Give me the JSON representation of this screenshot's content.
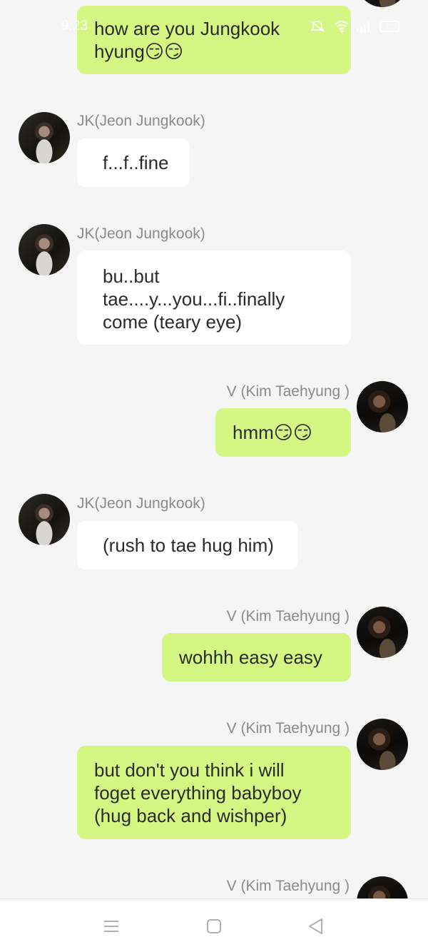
{
  "status_bar": {
    "time": "9:23",
    "battery": "77"
  },
  "chat": {
    "jk_name": "JK(Jeon Jungkook)",
    "v_name": "V (Kim Taehyung )",
    "messages": [
      {
        "sender": "V (Kim Taehyung )",
        "side": "right",
        "text_lines": [
          "how are you Jungkook",
          "hyung😏😏"
        ]
      },
      {
        "sender": "JK(Jeon Jungkook)",
        "side": "left",
        "text_lines": [
          "f...f..fine"
        ]
      },
      {
        "sender": "JK(Jeon Jungkook)",
        "side": "left",
        "text_lines": [
          "bu..but",
          "tae....y...you...fi..finally",
          "come (teary eye)"
        ]
      },
      {
        "sender": "V (Kim Taehyung )",
        "side": "right",
        "text_lines": [
          "hmm😏😏"
        ]
      },
      {
        "sender": "JK(Jeon Jungkook)",
        "side": "left",
        "text_lines": [
          "(rush to tae hug him)"
        ]
      },
      {
        "sender": "V (Kim Taehyung )",
        "side": "right",
        "text_lines": [
          "wohhh easy easy"
        ]
      },
      {
        "sender": "V (Kim Taehyung )",
        "side": "right",
        "text_lines": [
          "but don't you think i will",
          "foget everything babyboy",
          "(hug back and wishper)"
        ]
      },
      {
        "sender": "V (Kim Taehyung )",
        "side": "right",
        "text_lines": []
      }
    ]
  },
  "nav": {
    "icons": [
      "menu-icon",
      "home-square-icon",
      "back-triangle-icon"
    ]
  },
  "colors": {
    "background": "#f5f5f5",
    "incoming_bubble": "#ffffff",
    "outgoing_bubble": "#d4f784",
    "sender_name": "#8a8a8a"
  }
}
